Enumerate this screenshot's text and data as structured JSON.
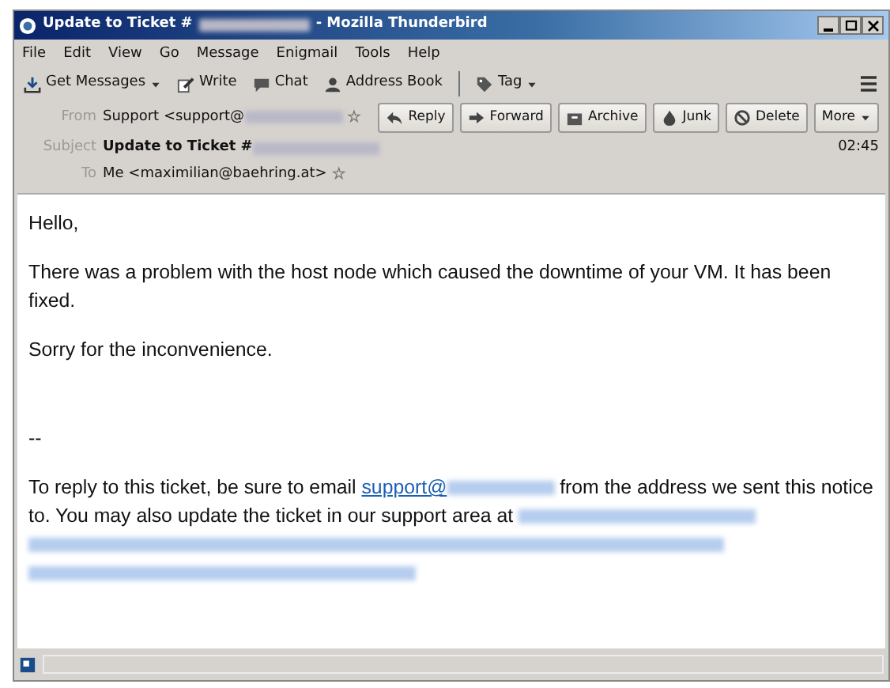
{
  "window": {
    "title_start": "Update to Ticket #",
    "title_end": "- Mozilla Thunderbird"
  },
  "menu": [
    "File",
    "Edit",
    "View",
    "Go",
    "Message",
    "Enigmail",
    "Tools",
    "Help"
  ],
  "toolbar": [
    {
      "kind": "get",
      "label": "Get Messages",
      "dropdown": true
    },
    {
      "kind": "write",
      "label": "Write",
      "dropdown": false
    },
    {
      "kind": "chat",
      "label": "Chat",
      "dropdown": false
    },
    {
      "kind": "book",
      "label": "Address Book",
      "dropdown": false
    },
    {
      "kind": "tag",
      "label": "Tag",
      "dropdown": true
    }
  ],
  "header": {
    "from_label": "From",
    "from": "Support <support@",
    "subject_label": "Subject",
    "subject": "Update to Ticket #",
    "time": "02:45",
    "to_label": "To",
    "to": "Me <maximilian@baehring.at>",
    "actions": [
      {
        "kind": "reply",
        "label": "Reply"
      },
      {
        "kind": "forward",
        "label": "Forward"
      },
      {
        "kind": "archive",
        "label": "Archive"
      },
      {
        "kind": "junk",
        "label": "Junk"
      },
      {
        "kind": "delete",
        "label": "Delete"
      },
      {
        "kind": "more",
        "label": "More"
      }
    ]
  },
  "body": {
    "paragraphs": [
      "Hello,",
      "There was a problem with the host node which caused the downtime of your VM. It has been fixed.",
      "Sorry for the inconvenience."
    ],
    "signature": "--",
    "reply_note_start": "To reply to this ticket, be sure to email",
    "reply_link": "support@",
    "reply_note_end": "from the address we sent this notice to. You may also update the ticket in our support area at"
  },
  "star_outline": "☆"
}
